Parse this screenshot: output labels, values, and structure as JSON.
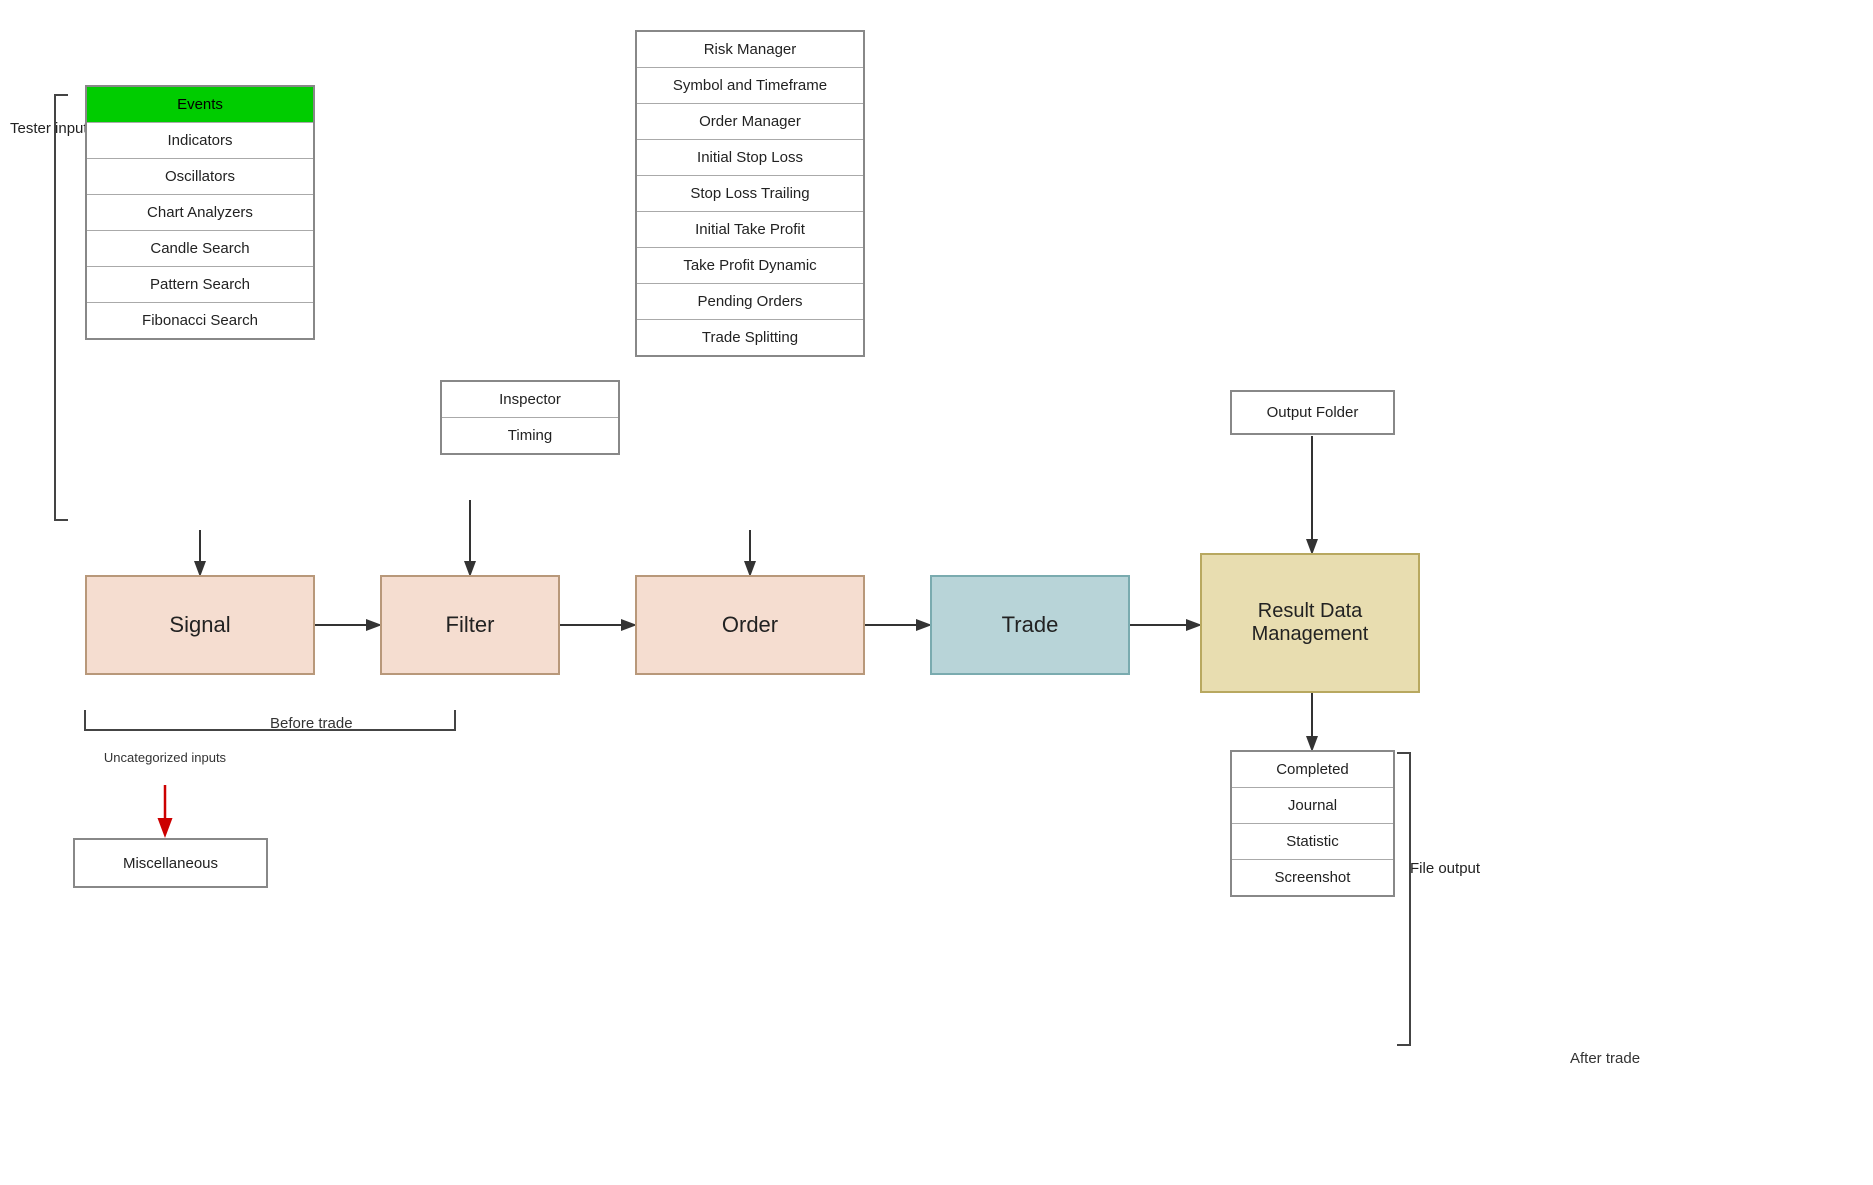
{
  "tester_input": {
    "label": "Tester input"
  },
  "signal_inputs": {
    "items": [
      {
        "label": "Events",
        "highlight": true
      },
      {
        "label": "Indicators",
        "highlight": false
      },
      {
        "label": "Oscillators",
        "highlight": false
      },
      {
        "label": "Chart Analyzers",
        "highlight": false
      },
      {
        "label": "Candle Search",
        "highlight": false
      },
      {
        "label": "Pattern Search",
        "highlight": false
      },
      {
        "label": "Fibonacci Search",
        "highlight": false
      }
    ]
  },
  "filter_inputs": {
    "items": [
      {
        "label": "Inspector"
      },
      {
        "label": "Timing"
      }
    ]
  },
  "order_inputs": {
    "items": [
      {
        "label": "Risk Manager"
      },
      {
        "label": "Symbol and Timeframe"
      },
      {
        "label": "Order Manager"
      },
      {
        "label": "Initial Stop Loss"
      },
      {
        "label": "Stop Loss Trailing"
      },
      {
        "label": "Initial Take Profit"
      },
      {
        "label": "Take Profit Dynamic"
      },
      {
        "label": "Pending Orders"
      },
      {
        "label": "Trade Splitting"
      }
    ]
  },
  "flow_boxes": {
    "signal": "Signal",
    "filter": "Filter",
    "order": "Order",
    "trade": "Trade",
    "result_data_management": "Result Data Management"
  },
  "output_folder": "Output Folder",
  "file_output": {
    "label": "File output",
    "items": [
      {
        "label": "Completed"
      },
      {
        "label": "Journal"
      },
      {
        "label": "Statistic"
      },
      {
        "label": "Screenshot"
      }
    ]
  },
  "before_trade_label": "Before trade",
  "after_trade_label": "After trade",
  "uncategorized_label": "Uncategorized inputs",
  "miscellaneous_label": "Miscellaneous"
}
